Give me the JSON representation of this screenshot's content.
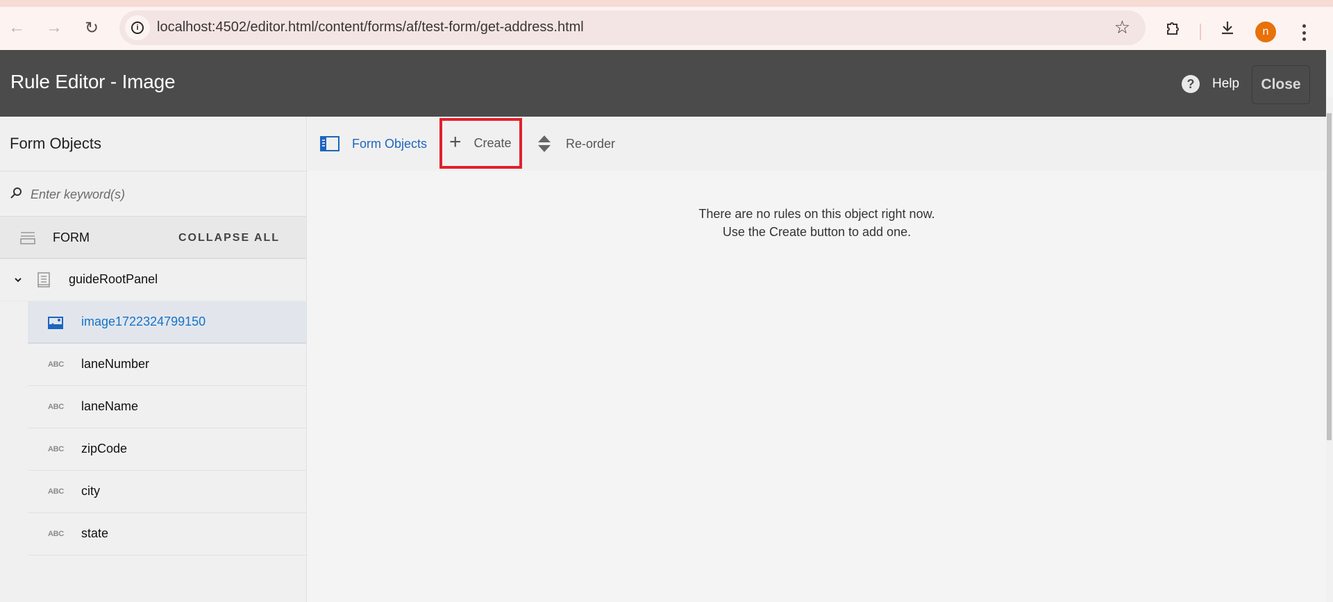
{
  "browser": {
    "url": "localhost:4502/editor.html/content/forms/af/test-form/get-address.html",
    "profile_initial": "n",
    "profile_color": "#e8710a",
    "icons": [
      "back-icon",
      "forward-icon",
      "reload-icon",
      "site-info-icon",
      "bookmark-star-icon",
      "extensions-icon",
      "downloads-icon",
      "menu-kebab-icon"
    ]
  },
  "header": {
    "title": "Rule Editor - Image",
    "help_label": "Help",
    "close_label": "Close",
    "background": "#4b4b4b"
  },
  "left_panel": {
    "title": "Form Objects",
    "search_placeholder": "Enter keyword(s)",
    "search_value": "",
    "form_label": "FORM",
    "collapse_all_label": "COLLAPSE ALL",
    "tree": {
      "root": {
        "label": "guideRootPanel",
        "expanded": true,
        "icon": "panel-icon"
      },
      "children": [
        {
          "label": "image1722324799150",
          "icon": "image-icon",
          "selected": true
        },
        {
          "label": "laneNumber",
          "icon": "abc-icon",
          "icon_text": "ABC"
        },
        {
          "label": "laneName",
          "icon": "abc-icon",
          "icon_text": "ABC"
        },
        {
          "label": "zipCode",
          "icon": "abc-icon",
          "icon_text": "ABC"
        },
        {
          "label": "city",
          "icon": "abc-icon",
          "icon_text": "ABC"
        },
        {
          "label": "state",
          "icon": "abc-icon",
          "icon_text": "ABC"
        }
      ]
    }
  },
  "toolbar": {
    "form_objects_label": "Form Objects",
    "create_label": "Create",
    "reorder_label": "Re-order",
    "accent": "#1d65c0",
    "highlight_border": "#e2202b"
  },
  "main": {
    "empty_line1": "There are no rules on this object right now.",
    "empty_line2": "Use the Create button to add one."
  }
}
